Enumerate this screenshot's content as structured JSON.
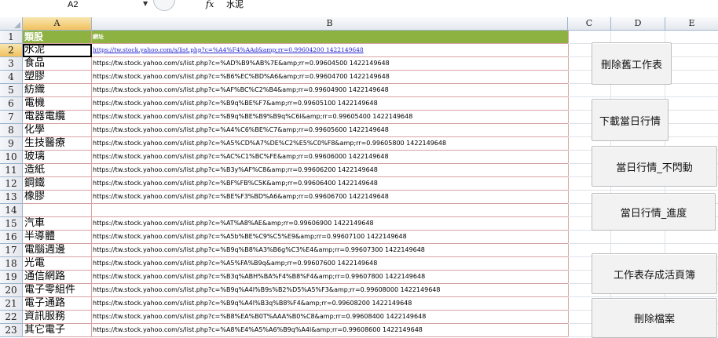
{
  "formula_bar": {
    "cell_ref": "A2",
    "fx_label": "fx",
    "value": "水泥"
  },
  "columns": [
    "A",
    "B",
    "C",
    "D",
    "E"
  ],
  "selected_column": "A",
  "selected_row": "2",
  "rows": [
    {
      "num": "1",
      "a": "類股",
      "b": "網址"
    },
    {
      "num": "2",
      "a": "水泥",
      "b": "https://tw.stock.yahoo.com/s/list.php?c=%A4%F4%AAd&amp;rr=0.99604200 1422149648"
    },
    {
      "num": "3",
      "a": "食品",
      "b": "https://tw.stock.yahoo.com/s/list.php?c=%AD%B9%AB%7E&amp;rr=0.99604500 1422149648"
    },
    {
      "num": "4",
      "a": "塑膠",
      "b": "https://tw.stock.yahoo.com/s/list.php?c=%B6%EC%BD%A6&amp;rr=0.99604700 1422149648"
    },
    {
      "num": "5",
      "a": "紡織",
      "b": "https://tw.stock.yahoo.com/s/list.php?c=%AF%BC%C2%B4&amp;rr=0.99604900 1422149648"
    },
    {
      "num": "6",
      "a": "電機",
      "b": "https://tw.stock.yahoo.com/s/list.php?c=%B9q%BE%F7&amp;rr=0.99605100 1422149648"
    },
    {
      "num": "7",
      "a": "電器電纜",
      "b": "https://tw.stock.yahoo.com/s/list.php?c=%B9q%BE%B9%B9q%C6l&amp;rr=0.99605400 1422149648"
    },
    {
      "num": "8",
      "a": "化學",
      "b": "https://tw.stock.yahoo.com/s/list.php?c=%A4%C6%BE%C7&amp;rr=0.99605600 1422149648"
    },
    {
      "num": "9",
      "a": "生技醫療",
      "b": "https://tw.stock.yahoo.com/s/list.php?c=%A5%CD%A7%DE%C2%E5%C0%F8&amp;rr=0.99605800 1422149648"
    },
    {
      "num": "10",
      "a": "玻璃",
      "b": "https://tw.stock.yahoo.com/s/list.php?c=%AC%C1%BC%FE&amp;rr=0.99606000 1422149648"
    },
    {
      "num": "11",
      "a": "造紙",
      "b": "https://tw.stock.yahoo.com/s/list.php?c=%B3y%AF%C8&amp;rr=0.99606200 1422149648"
    },
    {
      "num": "12",
      "a": "鋼鐵",
      "b": "https://tw.stock.yahoo.com/s/list.php?c=%BF%FB%C5K&amp;rr=0.99606400 1422149648"
    },
    {
      "num": "13",
      "a": "橡膠",
      "b": "https://tw.stock.yahoo.com/s/list.php?c=%BE%F3%BD%A6&amp;rr=0.99606700 1422149648"
    },
    {
      "num": "14",
      "a": "",
      "b": ""
    },
    {
      "num": "15",
      "a": "汽車",
      "b": "https://tw.stock.yahoo.com/s/list.php?c=%AT%A8%AE&amp;rr=0.99606900 1422149648"
    },
    {
      "num": "16",
      "a": "半導體",
      "b": "https://tw.stock.yahoo.com/s/list.php?c=%A5b%BE%C9%C5%E9&amp;rr=0.99607100 1422149648"
    },
    {
      "num": "17",
      "a": "電腦週邊",
      "b": "https://tw.stock.yahoo.com/s/list.php?c=%B9q%B8%A3%B6g%C3%E4&amp;rr=0.99607300 1422149648"
    },
    {
      "num": "18",
      "a": "光電",
      "b": "https://tw.stock.yahoo.com/s/list.php?c=%A5%FA%B9q&amp;rr=0.99607600 1422149648"
    },
    {
      "num": "19",
      "a": "通信網路",
      "b": "https://tw.stock.yahoo.com/s/list.php?c=%B3q%ABH%BA%F4%B8%F4&amp;rr=0.99607800 1422149648"
    },
    {
      "num": "20",
      "a": "電子零組件",
      "b": "https://tw.stock.yahoo.com/s/list.php?c=%B9q%A4l%B9s%B2%D5%A5%F3&amp;rr=0.99608000 1422149648"
    },
    {
      "num": "21",
      "a": "電子通路",
      "b": "https://tw.stock.yahoo.com/s/list.php?c=%B9q%A4l%B3q%B8%F4&amp;rr=0.99608200 1422149648"
    },
    {
      "num": "22",
      "a": "資訊服務",
      "b": "https://tw.stock.yahoo.com/s/list.php?c=%B8%EA%B0T%AAA%B0%C8&amp;rr=0.99608400 1422149648"
    },
    {
      "num": "23",
      "a": "其它電子",
      "b": "https://tw.stock.yahoo.com/s/list.php?c=%A8%E4%A5%A6%B9q%A4l&amp;rr=0.99608600 1422149648"
    }
  ],
  "buttons": [
    {
      "label": "刪除舊工作表"
    },
    {
      "label": "下載當日行情"
    },
    {
      "label": "當日行情_不閃動"
    },
    {
      "label": "當日行情_進度"
    },
    {
      "label": "工作表存成活頁簿"
    },
    {
      "label": "刪除檔案"
    }
  ]
}
